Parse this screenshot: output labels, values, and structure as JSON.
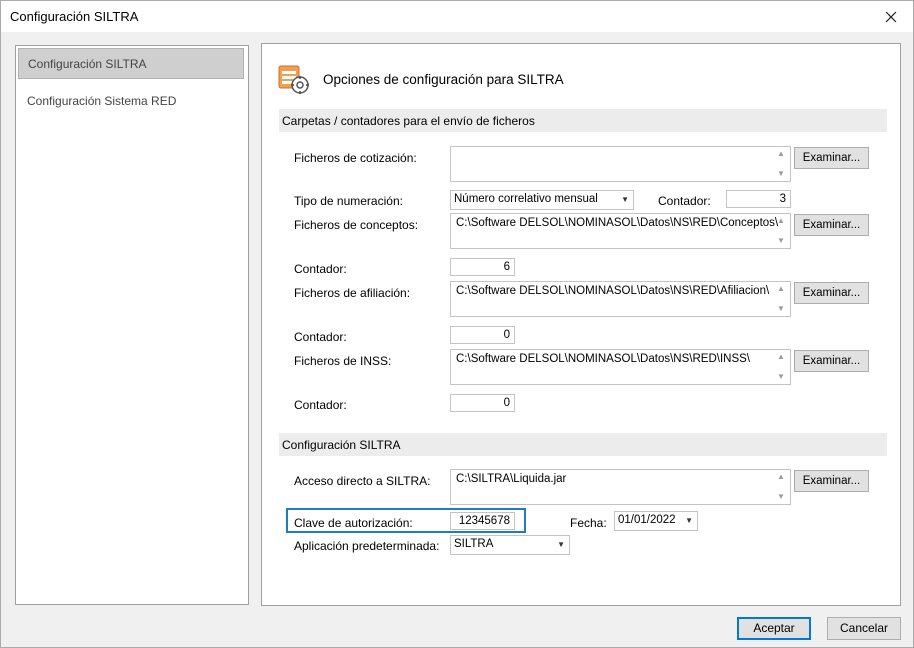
{
  "window": {
    "title": "Configuración SILTRA"
  },
  "nav": {
    "items": [
      {
        "label": "Configuración SILTRA",
        "selected": true
      },
      {
        "label": "Configuración Sistema RED",
        "selected": false
      }
    ]
  },
  "panel": {
    "header_title": "Opciones de configuración para SILTRA",
    "header_icon": "settings-folder-icon",
    "section1": "Carpetas / contadores para el envío de ficheros",
    "section2": "Configuración SILTRA",
    "ficheros_cotizacion": {
      "label": "Ficheros de cotización:",
      "value": "",
      "button": "Examinar..."
    },
    "tipo_numeracion": {
      "label": "Tipo de numeración:",
      "value": "Número correlativo mensual",
      "contador_label": "Contador:",
      "contador_value": "3"
    },
    "ficheros_conceptos": {
      "label": "Ficheros de conceptos:",
      "value": "C:\\Software DELSOL\\NOMINASOL\\Datos\\NS\\RED\\Conceptos\\",
      "button": "Examinar...",
      "contador_label": "Contador:",
      "contador_value": "6"
    },
    "ficheros_afiliacion": {
      "label": "Ficheros de afiliación:",
      "value": "C:\\Software DELSOL\\NOMINASOL\\Datos\\NS\\RED\\Afiliacion\\",
      "button": "Examinar...",
      "contador_label": "Contador:",
      "contador_value": "0"
    },
    "ficheros_inss": {
      "label": "Ficheros de INSS:",
      "value": "C:\\Software DELSOL\\NOMINASOL\\Datos\\NS\\RED\\INSS\\",
      "button": "Examinar...",
      "contador_label": "Contador:",
      "contador_value": "0"
    },
    "acceso_siltra": {
      "label": "Acceso directo a SILTRA:",
      "value": "C:\\SILTRA\\Liquida.jar",
      "button": "Examinar..."
    },
    "clave": {
      "label": "Clave de autorización:",
      "value": "12345678"
    },
    "fecha": {
      "label": "Fecha:",
      "value": "01/01/2022"
    },
    "aplicacion": {
      "label": "Aplicación predeterminada:",
      "value": "SILTRA"
    }
  },
  "footer": {
    "accept": "Aceptar",
    "cancel": "Cancelar"
  },
  "colors": {
    "highlight": "#1f7cc2",
    "default_button_border": "#0078d7"
  }
}
